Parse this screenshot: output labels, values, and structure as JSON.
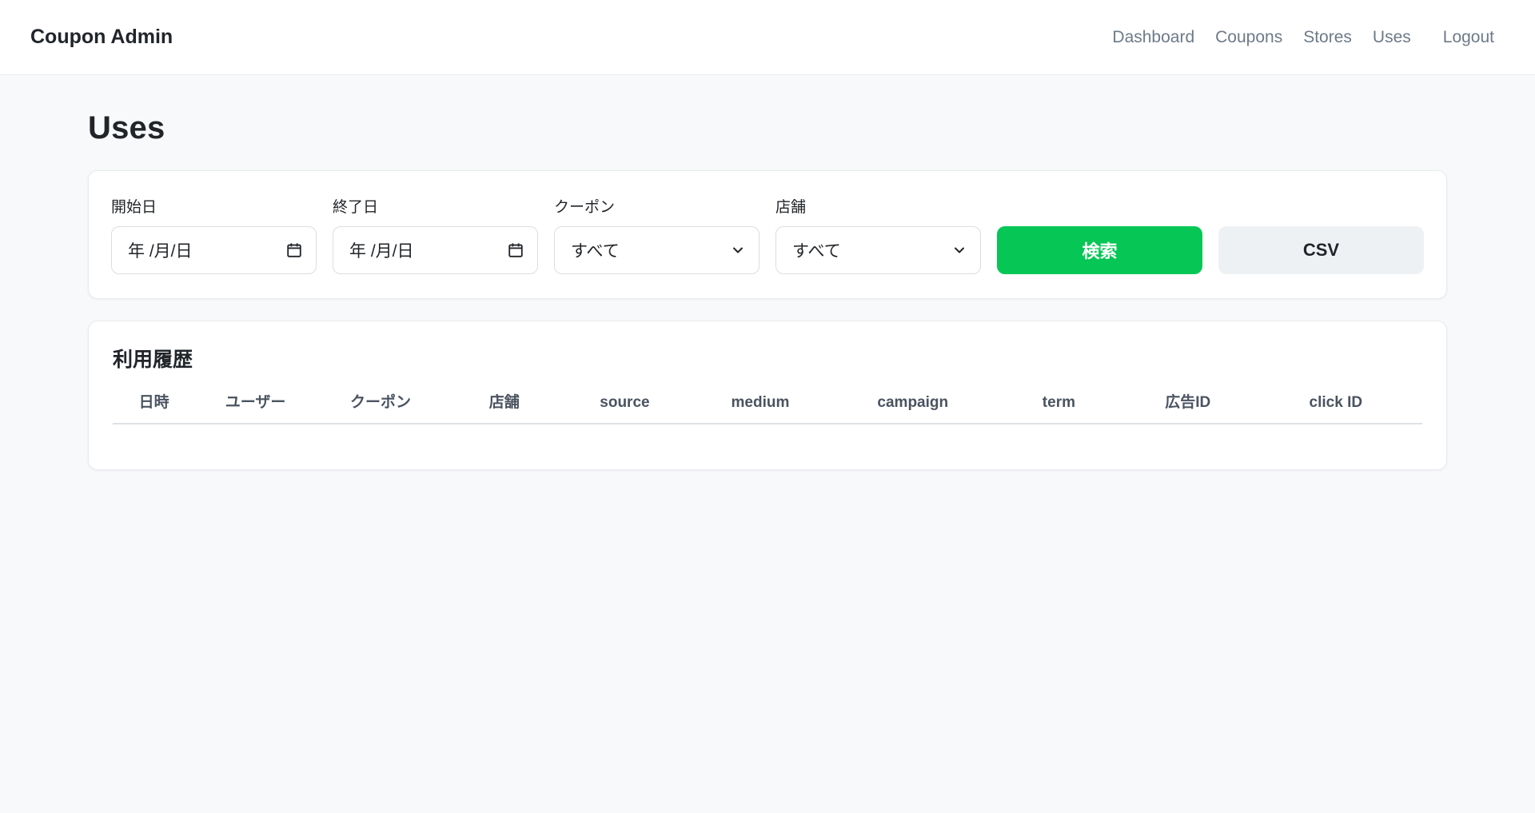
{
  "navbar": {
    "brand": "Coupon Admin",
    "links": [
      {
        "label": "Dashboard"
      },
      {
        "label": "Coupons"
      },
      {
        "label": "Stores"
      },
      {
        "label": "Uses"
      },
      {
        "label": "Logout"
      }
    ]
  },
  "page": {
    "title": "Uses"
  },
  "filters": {
    "start_date": {
      "label": "開始日",
      "value": "年 /月/日"
    },
    "end_date": {
      "label": "終了日",
      "value": "年 /月/日"
    },
    "coupon": {
      "label": "クーポン",
      "value": "すべて"
    },
    "store": {
      "label": "店舗",
      "value": "すべて"
    },
    "search_label": "検索",
    "csv_label": "CSV"
  },
  "history": {
    "title": "利用履歴",
    "columns": [
      "日時",
      "ユーザー",
      "クーポン",
      "店舗",
      "source",
      "medium",
      "campaign",
      "term",
      "広告ID",
      "click ID"
    ],
    "rows": []
  },
  "icons": {
    "calendar": "calendar-icon",
    "chevron": "chevron-down-icon"
  },
  "colors": {
    "accent_green": "#06C755",
    "csv_button_bg": "#eef1f4",
    "nav_link": "#6d7a88",
    "page_background": "#f8f9fa"
  }
}
